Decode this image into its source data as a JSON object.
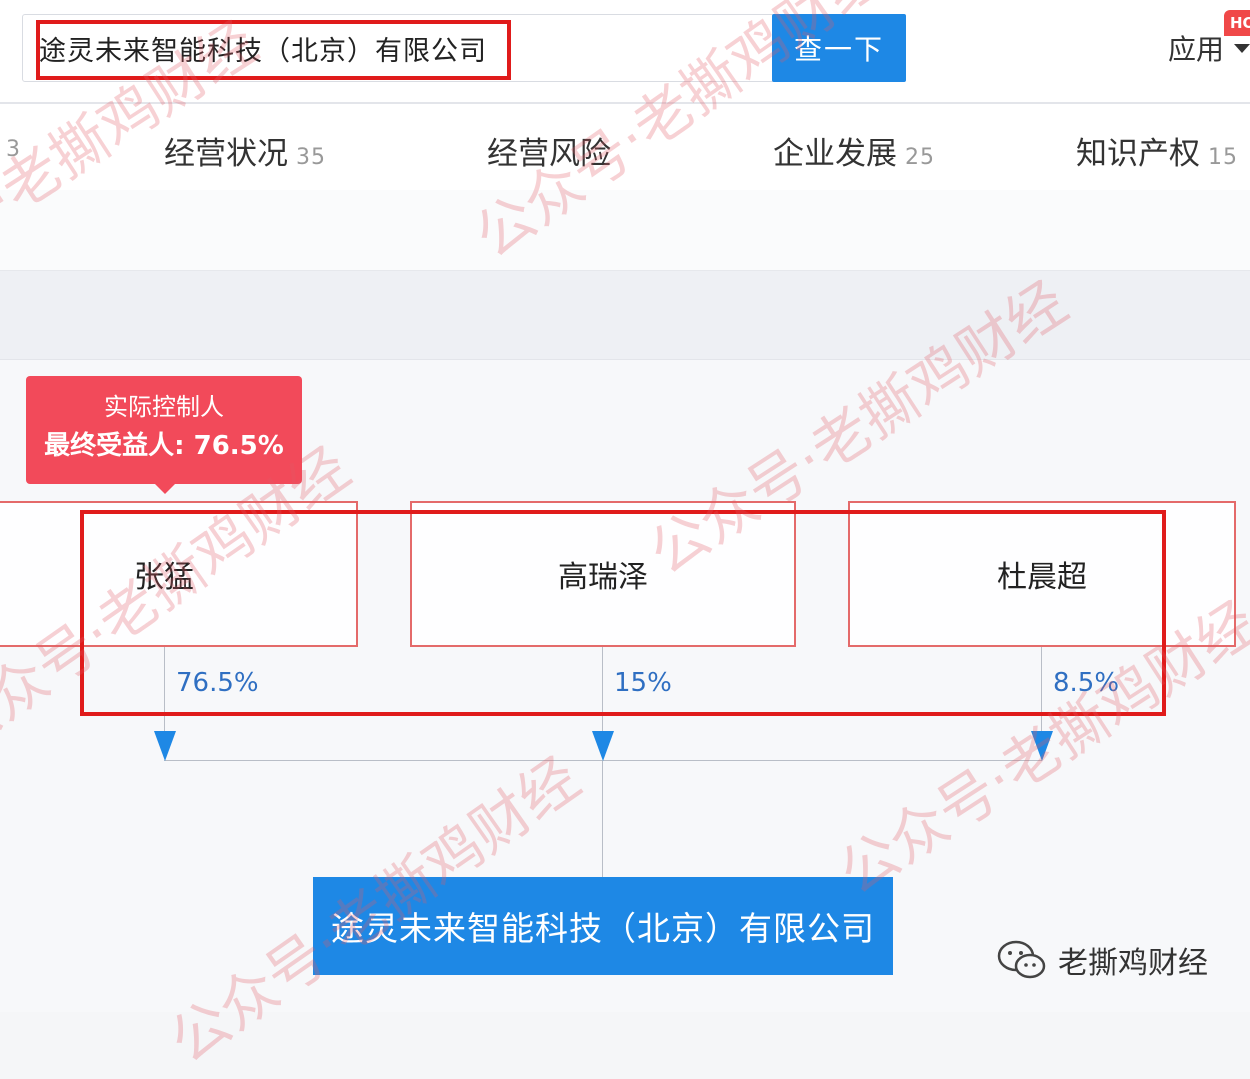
{
  "search": {
    "value": "途灵未来智能科技（北京）有限公司",
    "button_label": "查一下"
  },
  "header": {
    "app_menu_label": "应用",
    "badge": "HOT"
  },
  "tabs": [
    {
      "label": "",
      "count": "3"
    },
    {
      "label": "经营状况",
      "count": "35"
    },
    {
      "label": "经营风险",
      "count": ""
    },
    {
      "label": "企业发展",
      "count": "25"
    },
    {
      "label": "知识产权",
      "count": "15"
    }
  ],
  "graph": {
    "tooltip": {
      "line1": "实际控制人",
      "line2": "最终受益人: 76.5%"
    },
    "shareholders": [
      {
        "name": "张猛",
        "share": "76.5%"
      },
      {
        "name": "高瑞泽",
        "share": "15%"
      },
      {
        "name": "杜晨超",
        "share": "8.5%"
      }
    ],
    "company": "途灵未来智能科技（北京）有限公司"
  },
  "brand": {
    "icon": "wechat-icon",
    "name": "老撕鸡财经"
  },
  "watermark": {
    "text": "公众号·老撕鸡财经",
    "color": "#e25a64"
  },
  "colors": {
    "accent": "#1e88e5",
    "tooltip": "#f24a5a",
    "highlight": "#e01b1b",
    "percent": "#2f6fc2"
  }
}
